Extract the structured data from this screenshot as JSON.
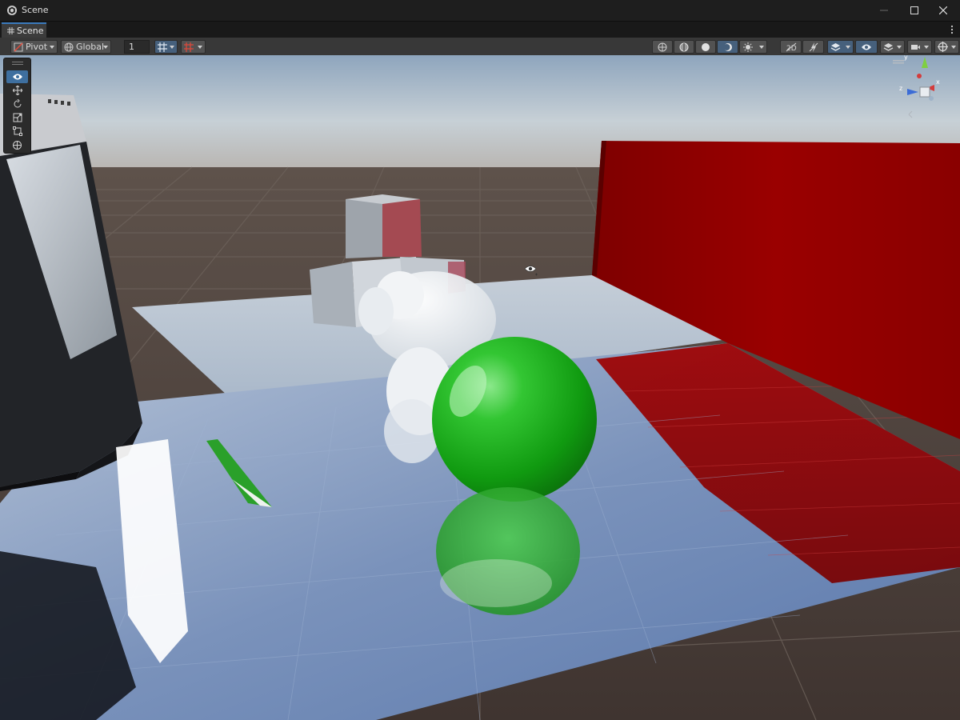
{
  "window": {
    "title": "Scene"
  },
  "tabs": [
    {
      "label": "Scene"
    }
  ],
  "toolbar": {
    "pivot_label": "Pivot",
    "global_label": "Global",
    "grid_snap_value": "1",
    "left_icons": [
      "pivot-icon",
      "globe-icon",
      "grid-snap-icon",
      "increment-snap-icon"
    ],
    "right_icons": [
      "shading-wireframe-icon",
      "shading-shaded-wireframe-icon",
      "shading-shaded-icon",
      "shading-lit-icon",
      "render-mode-icon",
      "2d-toggle-icon",
      "lighting-toggle-icon",
      "effects-icon",
      "scene-visibility-icon",
      "layers-icon",
      "camera-icon",
      "gizmos-icon"
    ]
  },
  "tools": [
    {
      "name": "view-tool",
      "icon": "eye-icon",
      "active": true
    },
    {
      "name": "move-tool",
      "icon": "move-icon",
      "active": false
    },
    {
      "name": "rotate-tool",
      "icon": "rotate-icon",
      "active": false
    },
    {
      "name": "scale-tool",
      "icon": "scale-icon",
      "active": false
    },
    {
      "name": "rect-tool",
      "icon": "rect-icon",
      "active": false
    },
    {
      "name": "transform-tool",
      "icon": "transform-icon",
      "active": false
    }
  ],
  "gizmo_axes": [
    "y",
    "x",
    "z"
  ],
  "colors": {
    "accent": "#3a79bb",
    "toolbar_bg": "#383838",
    "red_wall": "#8a0000",
    "green_sphere": "#1fa51f",
    "sky_top": "#9fb4c9",
    "ground": "#4a3d37"
  }
}
